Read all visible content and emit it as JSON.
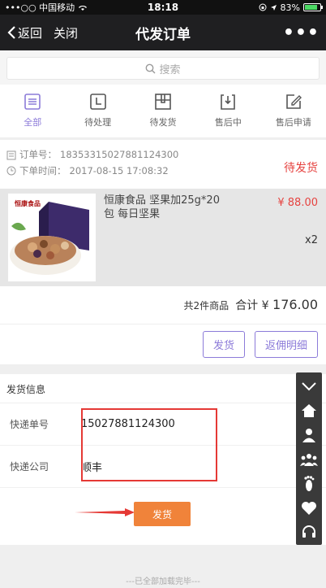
{
  "status_bar": {
    "carrier": "•••○○ 中国移动",
    "time": "18:18",
    "battery": "83%",
    "battery_level": 0.83
  },
  "nav": {
    "back_label": "返回",
    "close_label": "关闭",
    "title": "代发订单",
    "more_label": "•••"
  },
  "search": {
    "placeholder": "搜索"
  },
  "tabs": [
    {
      "label": "全部",
      "icon": "list-icon",
      "active": true
    },
    {
      "label": "待处理",
      "icon": "clock-icon"
    },
    {
      "label": "待发货",
      "icon": "box-icon"
    },
    {
      "label": "售后中",
      "icon": "return-icon"
    },
    {
      "label": "售后申请",
      "icon": "edit-icon"
    }
  ],
  "order": {
    "number_label": "订单号：",
    "number": "18353315027881124300",
    "time_label": "下单时间：",
    "time": "2017-08-15 17:08:32",
    "status": "待发货"
  },
  "product": {
    "name": "恒康食品 坚果加25g*20包 每日坚果",
    "price": "¥ 88.00",
    "quantity": "x2",
    "brand_mark": "恒康食品"
  },
  "total": {
    "count_text": "共2件商品",
    "sum_label": "合计",
    "currency": "¥",
    "amount": "176.00"
  },
  "actions": {
    "ship_label": "发货",
    "commission_label": "返佣明细"
  },
  "shipping": {
    "title": "发货信息",
    "tracking_label": "快递单号",
    "tracking_value": "15027881124300",
    "company_label": "快递公司",
    "company_value": "顺丰",
    "submit_label": "发货"
  },
  "footer": {
    "text": "---已全部加载完毕---"
  },
  "colors": {
    "accent": "#8c7bd9",
    "price_red": "#e64340",
    "ship_orange": "#f0833a",
    "highlight_red": "#e53935"
  }
}
